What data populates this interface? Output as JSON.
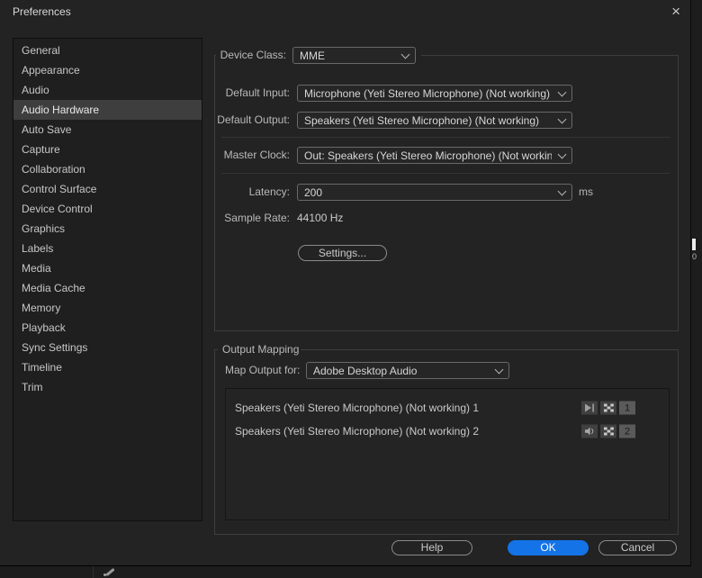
{
  "window": {
    "title": "Preferences",
    "close_glyph": "×"
  },
  "colors": {
    "accent_blue": "#1473e6",
    "dialog_bg": "#232323",
    "selected_item_bg": "#3e3e3e"
  },
  "sidebar": {
    "selected_index": 3,
    "items": [
      {
        "label": "General",
        "slug": "general"
      },
      {
        "label": "Appearance",
        "slug": "appearance"
      },
      {
        "label": "Audio",
        "slug": "audio"
      },
      {
        "label": "Audio Hardware",
        "slug": "audio-hardware"
      },
      {
        "label": "Auto Save",
        "slug": "auto-save"
      },
      {
        "label": "Capture",
        "slug": "capture"
      },
      {
        "label": "Collaboration",
        "slug": "collaboration"
      },
      {
        "label": "Control Surface",
        "slug": "control-surface"
      },
      {
        "label": "Device Control",
        "slug": "device-control"
      },
      {
        "label": "Graphics",
        "slug": "graphics"
      },
      {
        "label": "Labels",
        "slug": "labels"
      },
      {
        "label": "Media",
        "slug": "media"
      },
      {
        "label": "Media Cache",
        "slug": "media-cache"
      },
      {
        "label": "Memory",
        "slug": "memory"
      },
      {
        "label": "Playback",
        "slug": "playback"
      },
      {
        "label": "Sync Settings",
        "slug": "sync-settings"
      },
      {
        "label": "Timeline",
        "slug": "timeline"
      },
      {
        "label": "Trim",
        "slug": "trim"
      }
    ]
  },
  "hardware": {
    "device_class_label": "Device Class:",
    "device_class_value": "MME",
    "default_input_label": "Default Input:",
    "default_input_value": "Microphone (Yeti Stereo Microphone) (Not working)",
    "default_output_label": "Default Output:",
    "default_output_value": "Speakers (Yeti Stereo Microphone) (Not working)",
    "master_clock_label": "Master Clock:",
    "master_clock_value": "Out: Speakers (Yeti Stereo Microphone) (Not working)",
    "latency_label": "Latency:",
    "latency_value": "200",
    "latency_unit": "ms",
    "sample_rate_label": "Sample Rate:",
    "sample_rate_value": "44100 Hz",
    "settings_button": "Settings..."
  },
  "output_mapping": {
    "legend": "Output Mapping",
    "map_output_label": "Map Output for:",
    "map_output_value": "Adobe Desktop Audio",
    "channels": [
      {
        "label": "Speakers (Yeti Stereo Microphone) (Not working) 1",
        "number": "1",
        "icon": "play-icon"
      },
      {
        "label": "Speakers (Yeti Stereo Microphone) (Not working) 2",
        "number": "2",
        "icon": "speaker-icon"
      }
    ]
  },
  "footer": {
    "help_label": "Help",
    "ok_label": "OK",
    "cancel_label": "Cancel"
  },
  "background": {
    "meter_zero": "0"
  }
}
